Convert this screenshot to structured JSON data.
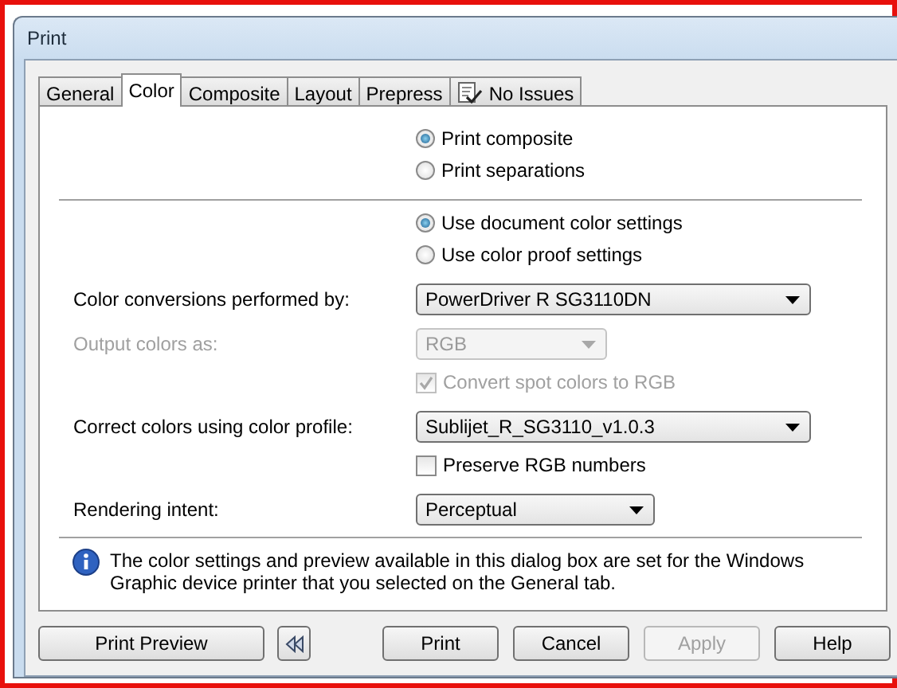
{
  "window": {
    "title": "Print"
  },
  "tabs": [
    {
      "label": "General",
      "selected": false,
      "kind": "text"
    },
    {
      "label": "Color",
      "selected": true,
      "kind": "text"
    },
    {
      "label": "Composite",
      "selected": false,
      "kind": "text"
    },
    {
      "label": "Layout",
      "selected": false,
      "kind": "text"
    },
    {
      "label": "Prepress",
      "selected": false,
      "kind": "text"
    },
    {
      "label": "No Issues",
      "selected": false,
      "kind": "status"
    }
  ],
  "sections": [
    {
      "items": [
        {
          "kind": "radio",
          "label": "Print composite",
          "selected": true
        },
        {
          "kind": "radio",
          "label": "Print separations",
          "selected": false
        }
      ]
    },
    {
      "items": [
        {
          "kind": "radio",
          "label": "Use document color settings",
          "selected": true
        },
        {
          "kind": "radio",
          "label": "Use color proof settings",
          "selected": false
        },
        {
          "kind": "dropdown",
          "label": "Color conversions performed by:",
          "value": "PowerDriver R SG3110DN",
          "disabled": false
        },
        {
          "kind": "dropdown",
          "label": "Output colors as:",
          "value": "RGB",
          "disabled": true
        },
        {
          "kind": "checkbox",
          "label": "Convert spot colors to RGB",
          "checked": true,
          "disabled": true
        },
        {
          "kind": "dropdown",
          "label": "Correct colors using color profile:",
          "value": "Sublijet_R_SG3110_v1.0.3",
          "disabled": false
        },
        {
          "kind": "checkbox",
          "label": "Preserve RGB numbers",
          "checked": false,
          "disabled": false
        },
        {
          "kind": "dropdown",
          "label": "Rendering intent:",
          "value": "Perceptual",
          "disabled": false
        }
      ]
    }
  ],
  "info": {
    "text": "The color settings and preview available in this dialog box are set for the Windows Graphic device printer that you selected on the General tab."
  },
  "buttons": [
    {
      "kind": "text",
      "label": "Print Preview",
      "disabled": false
    },
    {
      "kind": "rewind",
      "disabled": false
    },
    {
      "kind": "text",
      "label": "Print",
      "disabled": false
    },
    {
      "kind": "text",
      "label": "Cancel",
      "disabled": false
    },
    {
      "kind": "text",
      "label": "Apply",
      "disabled": true
    },
    {
      "kind": "text",
      "label": "Help",
      "disabled": false
    }
  ]
}
